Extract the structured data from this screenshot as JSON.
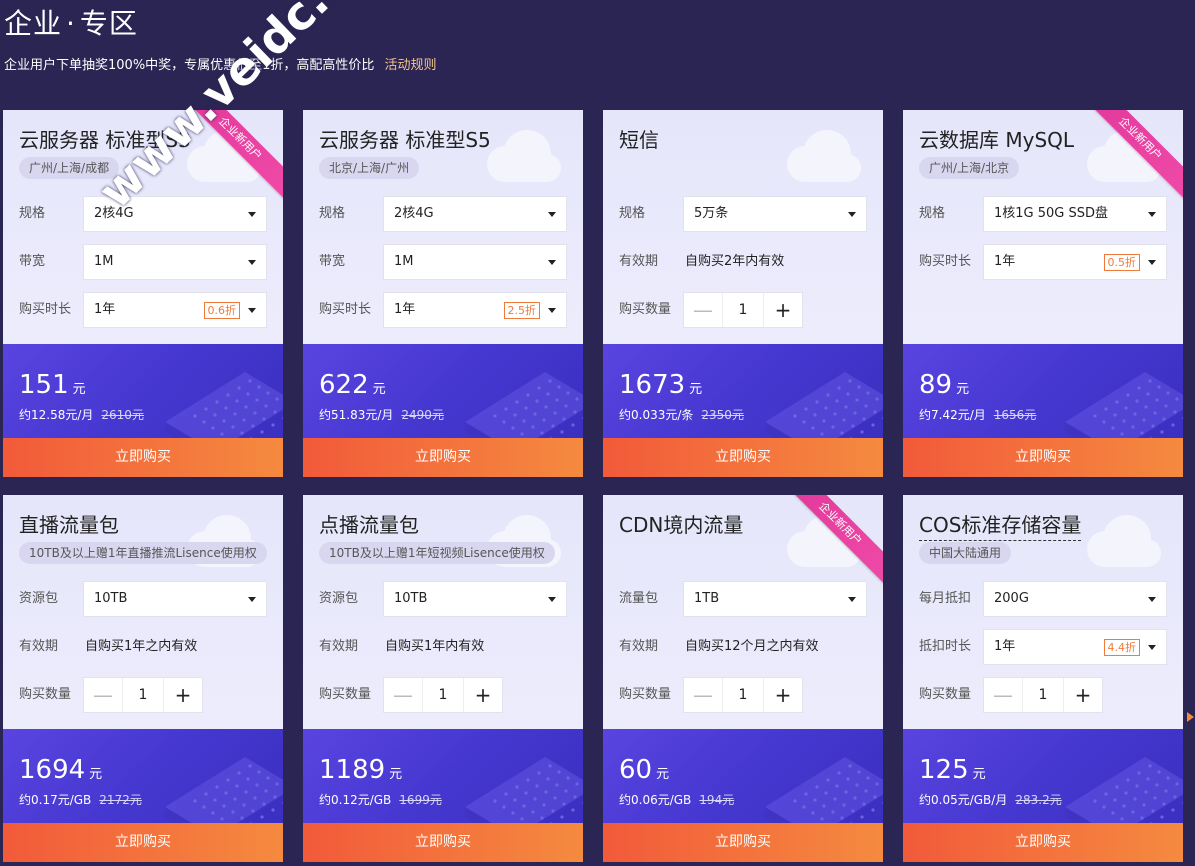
{
  "header": {
    "title_part1": "企业",
    "title_dot": "·",
    "title_part2": "专区",
    "subtitle": "企业用户下单抽奖100%中奖，专属优惠低至1折，高配高性价比",
    "rules_link": "活动规则"
  },
  "watermark": "www.veidc.com",
  "currency": "元",
  "buy_label": "立即购买",
  "qty_minus": "—",
  "qty_plus": "+",
  "cards": [
    {
      "title": "云服务器 标准型S3",
      "tag": "广州/上海/成都",
      "ribbon": "企业新用户",
      "rows": [
        {
          "label": "规格",
          "kind": "select",
          "value": "2核4G"
        },
        {
          "label": "带宽",
          "kind": "select",
          "value": "1M"
        },
        {
          "label": "购买时长",
          "kind": "select",
          "value": "1年",
          "discount": "0.6折"
        }
      ],
      "price": "151",
      "unit_price": "约12.58元/月",
      "original": "2610元"
    },
    {
      "title": "云服务器 标准型S5",
      "tag": "北京/上海/广州",
      "rows": [
        {
          "label": "规格",
          "kind": "select",
          "value": "2核4G"
        },
        {
          "label": "带宽",
          "kind": "select",
          "value": "1M"
        },
        {
          "label": "购买时长",
          "kind": "select",
          "value": "1年",
          "discount": "2.5折"
        }
      ],
      "price": "622",
      "unit_price": "约51.83元/月",
      "original": "2490元"
    },
    {
      "title": "短信",
      "rows": [
        {
          "label": "规格",
          "kind": "select",
          "value": "5万条"
        },
        {
          "label": "有效期",
          "kind": "text",
          "value": "自购买2年内有效"
        },
        {
          "label": "购买数量",
          "kind": "stepper",
          "value": "1"
        }
      ],
      "price": "1673",
      "unit_price": "约0.033元/条",
      "original": "2350元"
    },
    {
      "title": "云数据库 MySQL",
      "tag": "广州/上海/北京",
      "ribbon": "企业新用户",
      "rows": [
        {
          "label": "规格",
          "kind": "select",
          "value": "1核1G 50G SSD盘"
        },
        {
          "label": "购买时长",
          "kind": "select",
          "value": "1年",
          "discount": "0.5折"
        }
      ],
      "price": "89",
      "unit_price": "约7.42元/月",
      "original": "1656元"
    },
    {
      "title": "直播流量包",
      "tag": "10TB及以上赠1年直播推流Lisence使用权",
      "rows": [
        {
          "label": "资源包",
          "kind": "select",
          "value": "10TB"
        },
        {
          "label": "有效期",
          "kind": "text",
          "value": "自购买1年之内有效"
        },
        {
          "label": "购买数量",
          "kind": "stepper",
          "value": "1"
        }
      ],
      "price": "1694",
      "unit_price": "约0.17元/GB",
      "original": "2172元"
    },
    {
      "title": "点播流量包",
      "tag": "10TB及以上赠1年短视频Lisence使用权",
      "rows": [
        {
          "label": "资源包",
          "kind": "select",
          "value": "10TB"
        },
        {
          "label": "有效期",
          "kind": "text",
          "value": "自购买1年内有效"
        },
        {
          "label": "购买数量",
          "kind": "stepper",
          "value": "1"
        }
      ],
      "price": "1189",
      "unit_price": "约0.12元/GB",
      "original": "1699元"
    },
    {
      "title": "CDN境内流量",
      "ribbon": "企业新用户",
      "rows": [
        {
          "label": "流量包",
          "kind": "select",
          "value": "1TB"
        },
        {
          "label": "有效期",
          "kind": "text",
          "value": "自购买12个月之内有效"
        },
        {
          "label": "购买数量",
          "kind": "stepper",
          "value": "1"
        }
      ],
      "price": "60",
      "unit_price": "约0.06元/GB",
      "original": "194元"
    },
    {
      "title": "COS标准存储容量",
      "title_dashed": true,
      "tag": "中国大陆通用",
      "rows": [
        {
          "label": "每月抵扣",
          "kind": "select",
          "value": "200G"
        },
        {
          "label": "抵扣时长",
          "kind": "select",
          "value": "1年",
          "discount": "4.4折"
        },
        {
          "label": "购买数量",
          "kind": "stepper",
          "value": "1"
        }
      ],
      "price": "125",
      "unit_price": "约0.05元/GB/月",
      "original": "283.2元"
    }
  ]
}
